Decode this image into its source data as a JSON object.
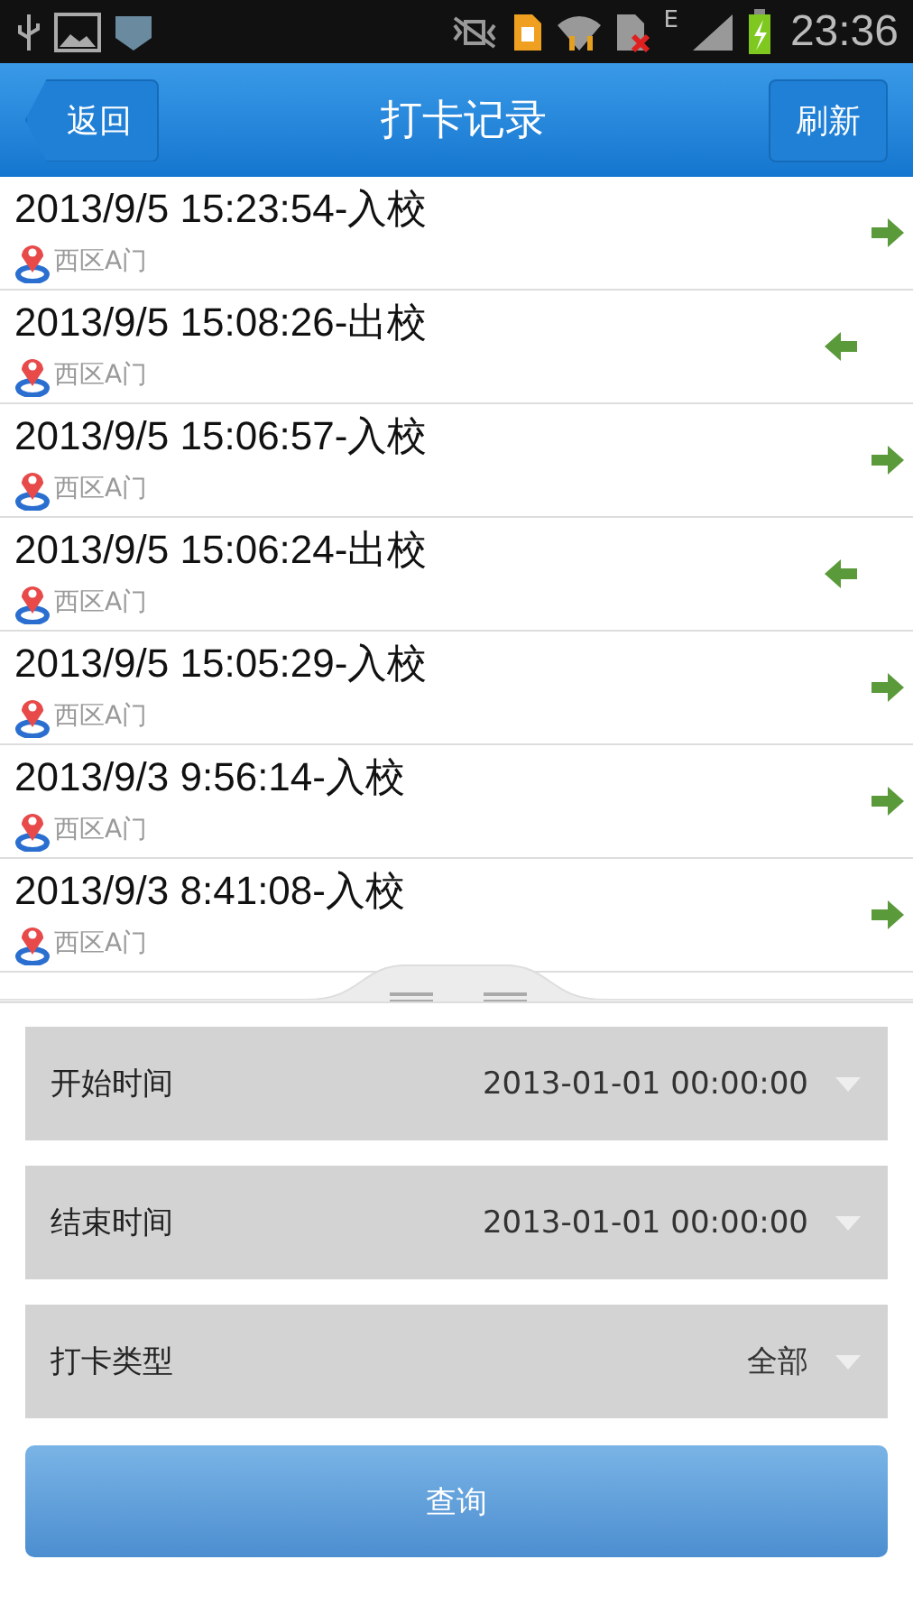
{
  "status_bar": {
    "network": "E",
    "time": "23:36"
  },
  "header": {
    "back": "返回",
    "title": "打卡记录",
    "refresh": "刷新"
  },
  "records": [
    {
      "text": "2013/9/5 15:23:54-入校",
      "location": "西区A门",
      "kind": "in"
    },
    {
      "text": "2013/9/5 15:08:26-出校",
      "location": "西区A门",
      "kind": "out"
    },
    {
      "text": "2013/9/5 15:06:57-入校",
      "location": "西区A门",
      "kind": "in"
    },
    {
      "text": "2013/9/5 15:06:24-出校",
      "location": "西区A门",
      "kind": "out"
    },
    {
      "text": "2013/9/5 15:05:29-入校",
      "location": "西区A门",
      "kind": "in"
    },
    {
      "text": "2013/9/3 9:56:14-入校",
      "location": "西区A门",
      "kind": "in"
    },
    {
      "text": "2013/9/3 8:41:08-入校",
      "location": "西区A门",
      "kind": "in"
    }
  ],
  "filters": [
    {
      "label": "开始时间",
      "value": "2013-01-01 00:00:00"
    },
    {
      "label": "结束时间",
      "value": "2013-01-01 00:00:00"
    },
    {
      "label": "打卡类型",
      "value": "全部"
    }
  ],
  "query_button": "查询"
}
